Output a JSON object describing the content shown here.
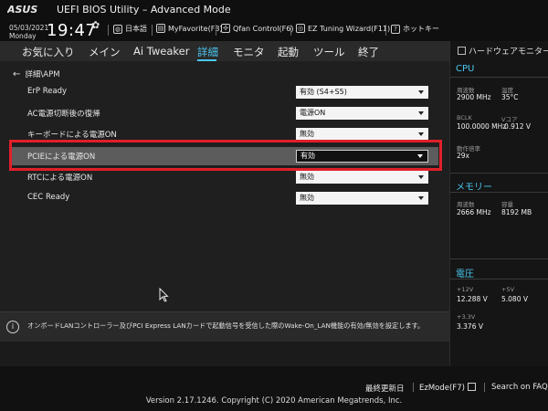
{
  "header": {
    "logo": "ASUS",
    "title": "UEFI BIOS Utility – Advanced Mode"
  },
  "infobar": {
    "date": "05/03/2021",
    "day": "Monday",
    "time": "19:47",
    "language": "日本語",
    "myfavorite": "MyFavorite(F3)",
    "qfan": "Qfan Control(F6)",
    "ez_tuning": "EZ Tuning Wizard(F11)",
    "hotkey": "ホットキー"
  },
  "menu": {
    "items": [
      "お気に入り",
      "メイン",
      "Ai Tweaker",
      "詳細",
      "モニタ",
      "起動",
      "ツール",
      "終了"
    ],
    "active": "詳細"
  },
  "main": {
    "breadcrumb": "詳細\\APM",
    "settings": [
      {
        "label": "ErP Ready",
        "value": "有効 (S4+S5)"
      },
      {
        "label": "AC電源切断後の復帰",
        "value": "電源ON"
      },
      {
        "label": "キーボードによる電源ON",
        "value": "無効"
      },
      {
        "label": "PCIEによる電源ON",
        "value": "有効"
      },
      {
        "label": "RTCによる電源ON",
        "value": "無効"
      },
      {
        "label": "CEC Ready",
        "value": "無効"
      }
    ],
    "selected_index": 3,
    "accent_color": "#4ac8f0",
    "highlight_color": "#e0202a"
  },
  "help": {
    "text": "オンボードLANコントローラー及びPCI Express LANカードで起動信号を受信した際のWake-On_LAN機能の有効/無効を設定します。"
  },
  "monitor": {
    "title": "ハードウェアモニター",
    "cpu": {
      "heading": "CPU",
      "freq_label": "周波数",
      "freq": "2900 MHz",
      "temp_label": "温度",
      "temp": "35°C",
      "bclk_label": "BCLK",
      "bclk": "100.0000 MHz",
      "vcore_label": "Vコア",
      "vcore": "0.912 V",
      "ratio_label": "動作倍率",
      "ratio": "29x"
    },
    "memory": {
      "heading": "メモリー",
      "freq_label": "周波数",
      "freq": "2666 MHz",
      "cap_label": "容量",
      "cap": "8192 MB"
    },
    "voltage": {
      "heading": "電圧",
      "v12_label": "+12V",
      "v12": "12.288 V",
      "v5_label": "+5V",
      "v5": "5.080 V",
      "v33_label": "+3.3V",
      "v33": "3.376 V"
    }
  },
  "footer": {
    "last_modified": "最終更新日",
    "ezmode": "EzMode(F7)",
    "faq": "Search on FAQ",
    "copyright": "Version 2.17.1246. Copyright (C) 2020 American Megatrends, Inc."
  }
}
